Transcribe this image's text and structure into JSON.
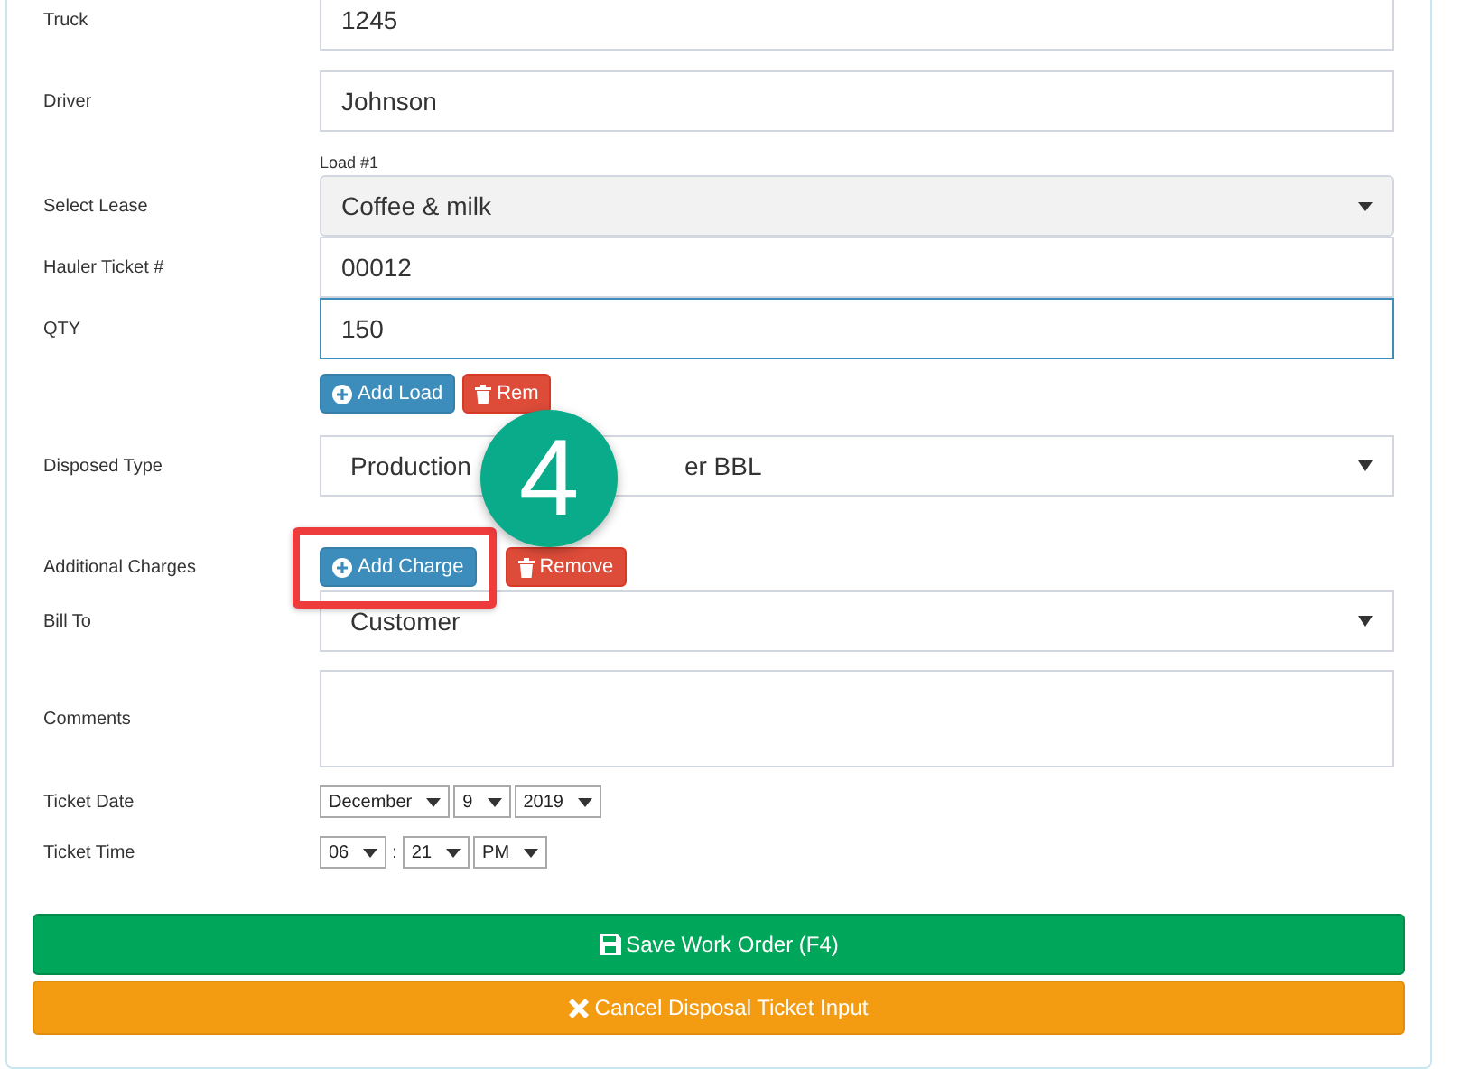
{
  "rows": [
    {
      "kind": "input",
      "label": "Truck",
      "value": "1245",
      "focused": false
    },
    {
      "kind": "input",
      "label": "Driver",
      "value": "Johnson",
      "focused": false
    },
    {
      "kind": "caption",
      "text": "Load #1"
    },
    {
      "kind": "lease",
      "label": "Select Lease",
      "value": "Coffee & milk"
    },
    {
      "kind": "input",
      "label": "Hauler Ticket #",
      "value": "00012",
      "focused": false
    },
    {
      "kind": "input",
      "label": "QTY",
      "value": "150",
      "focused": true
    },
    {
      "kind": "buttons",
      "buttons": [
        {
          "kind": "add",
          "label": "Add Load",
          "highlighted": false
        },
        {
          "kind": "remove",
          "label": "Rem",
          "highlighted": false
        }
      ]
    },
    {
      "kind": "select",
      "label": "Disposed Type",
      "value_parts": [
        "Production",
        "er BBL"
      ]
    },
    {
      "kind": "buttons",
      "label": "Additional Charges",
      "buttons": [
        {
          "kind": "add",
          "label": "Add Charge",
          "highlighted": true
        },
        {
          "kind": "remove",
          "label": "Remove",
          "highlighted": false
        }
      ]
    },
    {
      "kind": "select",
      "label": "Bill To",
      "value_parts": [
        "Customer"
      ]
    },
    {
      "kind": "textarea",
      "label": "Comments"
    },
    {
      "kind": "combos",
      "label": "Ticket Date",
      "parts": [
        {
          "kind": "combo",
          "text": "December"
        },
        {
          "kind": "combo",
          "text": "9"
        },
        {
          "kind": "combo",
          "text": "2019"
        }
      ]
    },
    {
      "kind": "combos",
      "label": "Ticket Time",
      "parts": [
        {
          "kind": "combo",
          "text": "06"
        },
        {
          "kind": "separator",
          "text": ":"
        },
        {
          "kind": "combo",
          "text": "21"
        },
        {
          "kind": "combo",
          "text": "PM"
        }
      ]
    }
  ],
  "actions": [
    {
      "kind": "save",
      "label": "Save Work Order (F4)"
    },
    {
      "kind": "cancel",
      "label": "Cancel Disposal Ticket Input"
    }
  ],
  "callout": {
    "number": "4"
  }
}
